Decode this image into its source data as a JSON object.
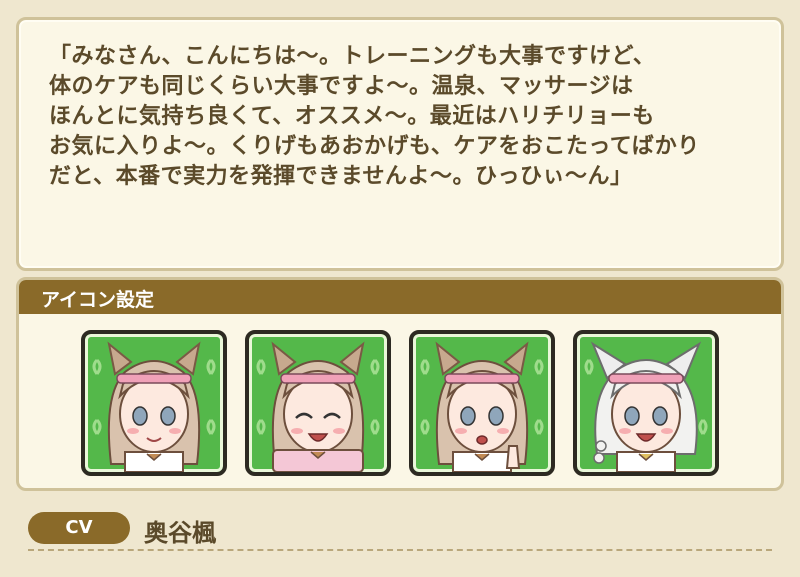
{
  "quote": {
    "text": "「みなさん、こんにちは～。トレーニングも大事ですけど、\n体のケアも同じくらい大事ですよ～。温泉、マッサージは\nほんとに気持ち良くて、オススメ～。最近はハリチリョーも\nお気に入りよ～。くりげもあおかげも、ケアをおこたってばかり\nだと、本番で実力を発揮できませんよ～。ひっひぃ～ん」"
  },
  "icon_settings": {
    "title": "アイコン設定",
    "icons": [
      {
        "name": "portrait-smile"
      },
      {
        "name": "portrait-laugh"
      },
      {
        "name": "portrait-pointing"
      },
      {
        "name": "portrait-alt-outfit"
      }
    ]
  },
  "cv": {
    "label": "CV",
    "name": "奥谷楓"
  },
  "colors": {
    "accent_brown": "#8a6a29",
    "panel_bg": "#fbf7e6",
    "tile_green": "#54b84a",
    "text_brown": "#5b4a2a"
  }
}
